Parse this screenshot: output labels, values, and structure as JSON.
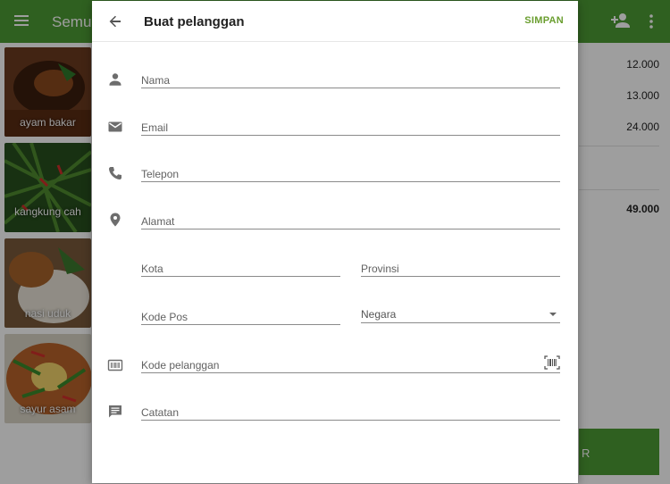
{
  "background": {
    "app_title": "Semua",
    "menu_icon": "menu-icon",
    "add_customer_icon": "add-person-icon",
    "more_icon": "more-vertical-icon",
    "items": [
      {
        "name": "ayam bakar"
      },
      {
        "name": "kangkung cah"
      },
      {
        "name": "nasi uduk"
      },
      {
        "name": "sayur asam"
      }
    ],
    "order_prices": [
      "12.000",
      "13.000",
      "24.000"
    ],
    "order_total": "49.000",
    "charge_label": "R"
  },
  "dialog": {
    "title": "Buat pelanggan",
    "save_label": "SIMPAN",
    "back_icon": "arrow-back-icon",
    "fields": {
      "name": {
        "placeholder": "Nama",
        "value": ""
      },
      "email": {
        "placeholder": "Email",
        "value": ""
      },
      "phone": {
        "placeholder": "Telepon",
        "value": ""
      },
      "address": {
        "placeholder": "Alamat",
        "value": ""
      },
      "city": {
        "placeholder": "Kota",
        "value": ""
      },
      "province": {
        "placeholder": "Provinsi",
        "value": ""
      },
      "postal_code": {
        "placeholder": "Kode Pos",
        "value": ""
      },
      "country": {
        "label": "Negara",
        "value": ""
      },
      "customer_code": {
        "placeholder": "Kode pelanggan",
        "value": ""
      },
      "note": {
        "placeholder": "Catatan",
        "value": ""
      }
    },
    "icons": {
      "name": "person-icon",
      "email": "envelope-icon",
      "phone": "phone-icon",
      "address": "location-pin-icon",
      "customer_code": "barcode-icon",
      "note": "comment-icon",
      "scan": "barcode-scan-icon"
    }
  },
  "colors": {
    "accent": "#4d9b35",
    "save": "#6a9e2f",
    "scrim": "rgba(0,0,0,0.38)"
  }
}
